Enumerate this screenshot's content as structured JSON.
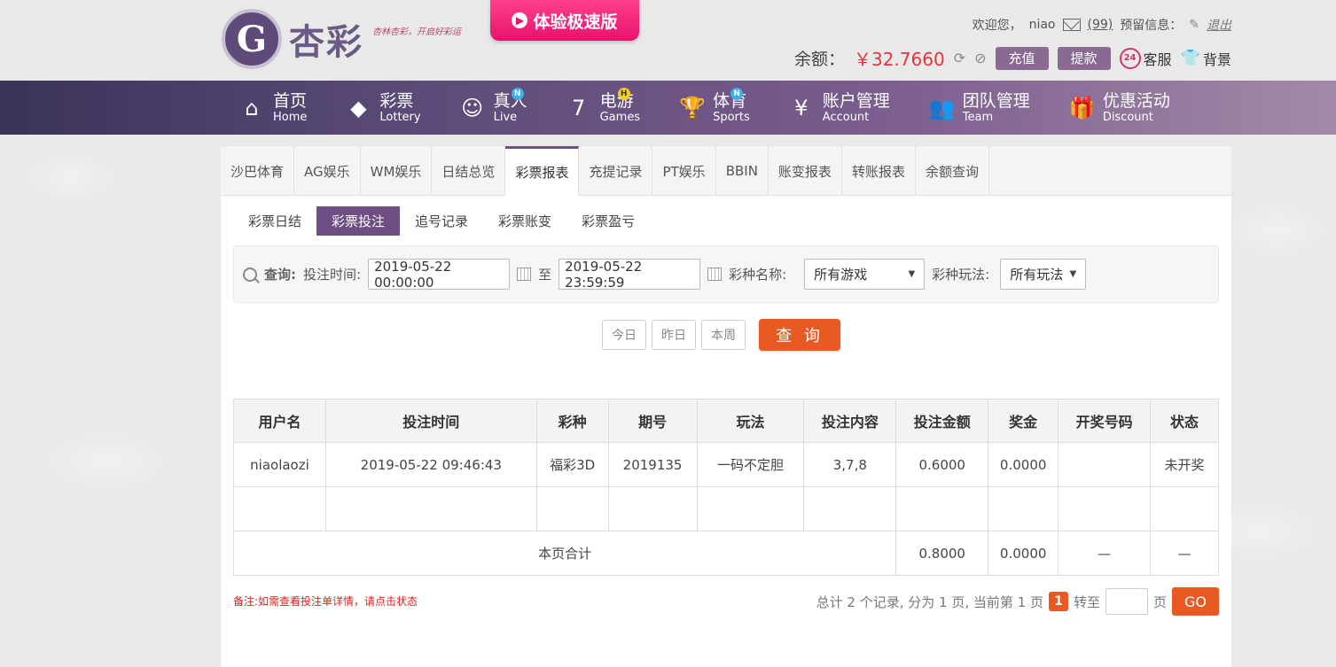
{
  "header": {
    "logo_text": "杏彩",
    "slogan": "杏林杏彩，开启好彩运",
    "promo_label": "体验极速版",
    "welcome": "欢迎您，",
    "username": "niao",
    "message_count": "(99)",
    "reserved_info": "预留信息：",
    "logout": "退出",
    "balance_label": "余额：",
    "balance_value": "￥32.7660",
    "recharge": "充值",
    "withdraw": "提款",
    "service": "客服",
    "background": "背景"
  },
  "nav": [
    {
      "cn": "首页",
      "en": "Home",
      "icon": "home-icon",
      "badge": ""
    },
    {
      "cn": "彩票",
      "en": "Lottery",
      "icon": "lottery-icon",
      "badge": ""
    },
    {
      "cn": "真人",
      "en": "Live",
      "icon": "live-icon",
      "badge": "N"
    },
    {
      "cn": "电游",
      "en": "Games",
      "icon": "games-icon",
      "badge": "H"
    },
    {
      "cn": "体育",
      "en": "Sports",
      "icon": "trophy-icon",
      "badge": "N"
    },
    {
      "cn": "账户管理",
      "en": "Account",
      "icon": "account-icon",
      "badge": ""
    },
    {
      "cn": "团队管理",
      "en": "Team",
      "icon": "team-icon",
      "badge": ""
    },
    {
      "cn": "优惠活动",
      "en": "Discount",
      "icon": "gift-icon",
      "badge": ""
    }
  ],
  "tabs": [
    "沙巴体育",
    "AG娱乐",
    "WM娱乐",
    "日结总览",
    "彩票报表",
    "充提记录",
    "PT娱乐",
    "BBIN",
    "账变报表",
    "转账报表",
    "余额查询"
  ],
  "active_tab": "彩票报表",
  "subtabs": [
    "彩票日结",
    "彩票投注",
    "追号记录",
    "彩票账变",
    "彩票盈亏"
  ],
  "active_subtab": "彩票投注",
  "filter": {
    "query_label": "查询:",
    "time_label": "投注时间:",
    "start": "2019-05-22 00:00:00",
    "to": "至",
    "end": "2019-05-22 23:59:59",
    "game_label": "彩种名称:",
    "game_value": "所有游戏",
    "play_label": "彩种玩法:",
    "play_value": "所有玩法"
  },
  "quick": [
    "今日",
    "昨日",
    "本周"
  ],
  "query_button": "查 询",
  "table": {
    "headers": [
      "用户名",
      "投注时间",
      "彩种",
      "期号",
      "玩法",
      "投注内容",
      "投注金额",
      "奖金",
      "开奖号码",
      "状态"
    ],
    "rows": [
      [
        "niaolaozi",
        "2019-05-22 09:46:43",
        "福彩3D",
        "2019135",
        "一码不定胆",
        "3,7,8",
        "0.6000",
        "0.0000",
        "",
        "未开奖"
      ]
    ],
    "total_label": "本页合计",
    "total_amount": "0.8000",
    "total_bonus": "0.0000",
    "total_numbers": "—",
    "total_status": "—"
  },
  "note": "备注:如需查看投注单详情，请点击状态",
  "pager": {
    "summary": "总计 2 个记录, 分为 1 页, 当前第 1 页",
    "current": "1",
    "goto": "转至",
    "page_unit": "页",
    "go": "GO"
  }
}
